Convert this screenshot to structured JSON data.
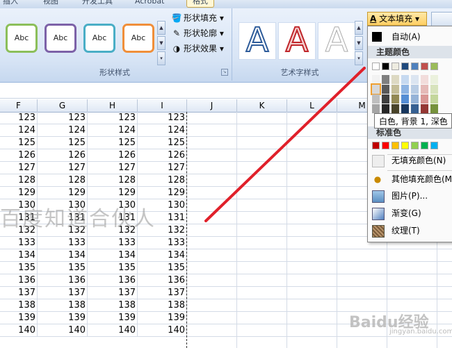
{
  "ribbon_tabs": [
    "插入",
    "视图",
    "开发工具",
    "Acrobat",
    "格式"
  ],
  "shape_styles": {
    "samples": [
      {
        "label": "Abc",
        "border": "#8cbf5a"
      },
      {
        "label": "Abc",
        "border": "#7d62a8"
      },
      {
        "label": "Abc",
        "border": "#4aaec6"
      },
      {
        "label": "Abc",
        "border": "#f08f3a"
      }
    ],
    "commands": [
      {
        "label": "形状填充",
        "icon": "paint-bucket-icon"
      },
      {
        "label": "形状轮廓",
        "icon": "pen-outline-icon"
      },
      {
        "label": "形状效果",
        "icon": "shape-effect-icon"
      }
    ],
    "group_label": "形状样式"
  },
  "wordart": {
    "samples": [
      {
        "glyph": "A",
        "style": "outline-blue"
      },
      {
        "glyph": "A",
        "style": "outline-red"
      },
      {
        "glyph": "A",
        "style": "outline-gray"
      }
    ],
    "group_label": "艺术字样式",
    "text_fill_label": "文本填充"
  },
  "columns": [
    "F",
    "G",
    "H",
    "I",
    "J",
    "K",
    "L",
    "M"
  ],
  "rows": [
    123,
    124,
    125,
    126,
    127,
    128,
    129,
    130,
    131,
    132,
    133,
    134,
    135,
    136,
    137,
    138,
    139,
    140
  ],
  "watermark": "百度知道合伙人",
  "menu": {
    "auto_label": "自动(A)",
    "theme_header": "主题颜色",
    "tooltip": "白色, 背景 1, 深色",
    "standard_header": "标准色",
    "theme_top": [
      "#ffffff",
      "#000000",
      "#eeece1",
      "#1f497d",
      "#4f81bd",
      "#c0504d",
      "#9bbb59"
    ],
    "theme_shades": [
      [
        "#f2f2f2",
        "#7f7f7f",
        "#ddd9c3",
        "#c6d9f0",
        "#dbe5f1",
        "#f2dcdb",
        "#ebf1dd"
      ],
      [
        "#d8d8d8",
        "#595959",
        "#c4bd97",
        "#8db3e2",
        "#b8cce4",
        "#e5b9b7",
        "#d7e3bc"
      ],
      [
        "#bfbfbf",
        "#3f3f3f",
        "#938953",
        "#548dd4",
        "#95b3d7",
        "#d99694",
        "#c3d69b"
      ],
      [
        "#a5a5a5",
        "#262626",
        "#494429",
        "#17365d",
        "#366092",
        "#953734",
        "#76923c"
      ]
    ],
    "standard": [
      "#c00000",
      "#ff0000",
      "#ffc000",
      "#ffff00",
      "#92d050",
      "#00b050",
      "#00b0f0"
    ],
    "items": [
      {
        "label": "无填充颜色(N)",
        "icon": "no-fill-icon"
      },
      {
        "label": "其他填充颜色(M)",
        "icon": "palette-icon"
      },
      {
        "label": "图片(P)...",
        "icon": "picture-icon"
      },
      {
        "label": "渐变(G)",
        "icon": "gradient-icon"
      },
      {
        "label": "纹理(T)",
        "icon": "texture-icon"
      }
    ]
  },
  "baidu_logo": "Baidu经验",
  "baidu_sub": "jingyan.baidu.com",
  "colors": {
    "annotation_line": "#e0202a",
    "selection_dash": "#333333"
  }
}
